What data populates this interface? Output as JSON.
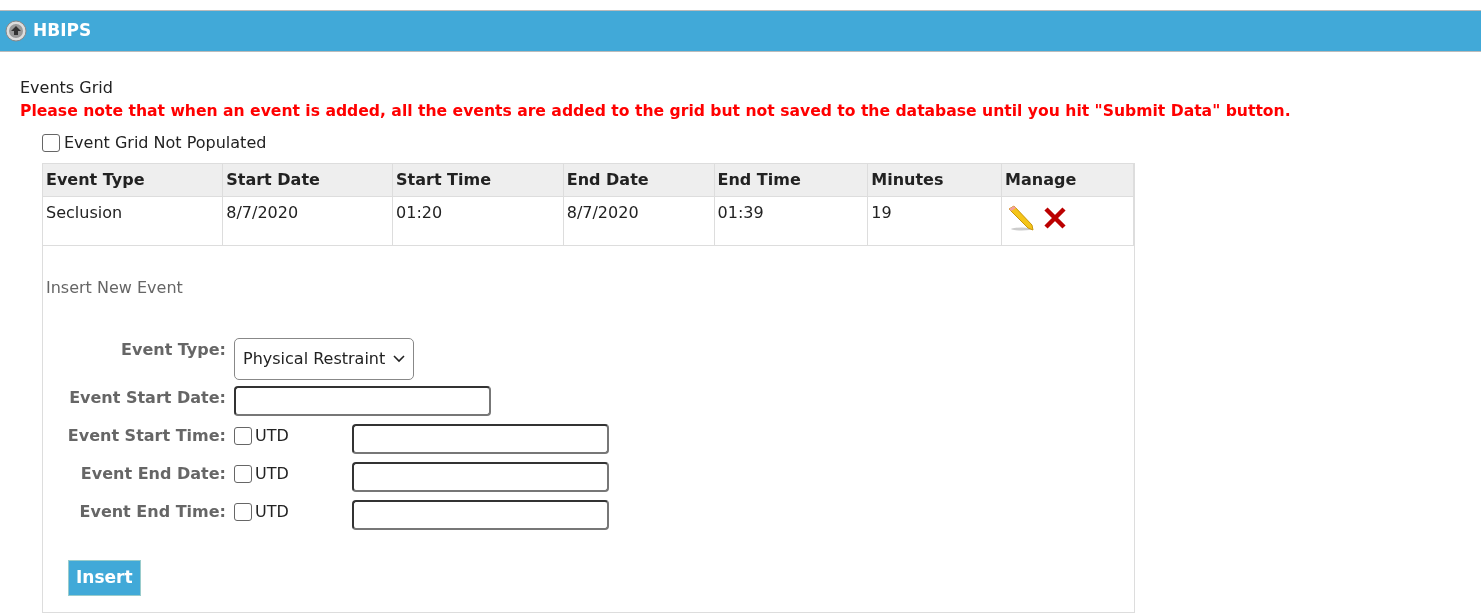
{
  "panel": {
    "title": "HBIPS",
    "expanded": true
  },
  "section_title": "Events Grid",
  "notice": "Please note that when an event is added, all the events are added to the grid but not saved to the database until you hit \"Submit Data\" button.",
  "not_populated": {
    "label": "Event Grid Not Populated",
    "checked": false
  },
  "table": {
    "columns": [
      "Event Type",
      "Start Date",
      "Start Time",
      "End Date",
      "End Time",
      "Minutes",
      "Manage"
    ],
    "rows": [
      {
        "cells": [
          "Seclusion",
          "8/7/2020",
          "01:20",
          "8/7/2020",
          "01:39",
          "19"
        ]
      }
    ]
  },
  "insert_form": {
    "title": "Insert New Event",
    "fields": [
      {
        "kind": "select",
        "label": "Event Type:",
        "value": "Physical Restraint"
      },
      {
        "kind": "text",
        "label": "Event Start Date:"
      },
      {
        "kind": "utd",
        "label": "Event Start Time:",
        "utd_label": "UTD",
        "checked": false
      },
      {
        "kind": "utd",
        "label": "Event End Date:",
        "utd_label": "UTD",
        "checked": false
      },
      {
        "kind": "utd",
        "label": "Event End Time:",
        "utd_label": "UTD",
        "checked": false
      }
    ],
    "button": "Insert"
  }
}
